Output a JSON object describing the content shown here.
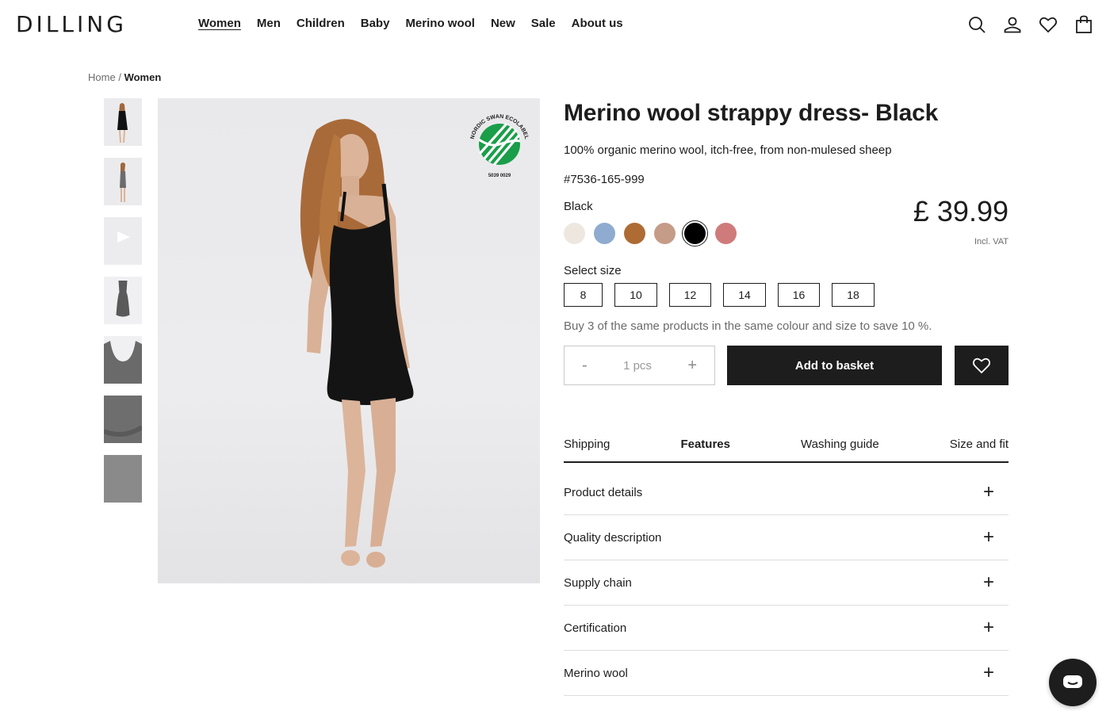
{
  "header": {
    "logo": "DILLING",
    "nav": [
      "Women",
      "Men",
      "Children",
      "Baby",
      "Merino wool",
      "New",
      "Sale",
      "About us"
    ],
    "active_nav": "Women",
    "icons": [
      "search-icon",
      "account-icon",
      "wishlist-icon",
      "basket-icon"
    ]
  },
  "breadcrumb": {
    "home": "Home",
    "separator": "/",
    "current": "Women"
  },
  "gallery": {
    "thumbnail_count": 7,
    "badge": {
      "arc_text": "NORDIC SWAN ECOLABEL",
      "number": "5039 0029"
    }
  },
  "product": {
    "title": "Merino wool strappy dress- Black",
    "subtitle": "100% organic merino wool, itch-free, from non-mulesed sheep",
    "sku": "#7536-165-999",
    "color_label": "Black",
    "colors": [
      "#ede7df",
      "#8fabcf",
      "#ae6b34",
      "#c49c88",
      "#000000",
      "#d07b7b"
    ],
    "selected_color_index": 4,
    "price": "£ 39.99",
    "vat_note": "Incl. VAT",
    "size_label": "Select size",
    "sizes": [
      "8",
      "10",
      "12",
      "14",
      "16",
      "18"
    ],
    "promo": "Buy 3 of the same products in the same colour and size to save 10 %.",
    "quantity": {
      "minus": "-",
      "value": "1 pcs",
      "plus": "+"
    },
    "add_to_basket": "Add to basket"
  },
  "tabs": {
    "items": [
      "Shipping",
      "Features",
      "Washing guide",
      "Size and fit"
    ],
    "active": "Features"
  },
  "accordion": {
    "items": [
      "Product details",
      "Quality description",
      "Supply chain",
      "Certification",
      "Merino wool"
    ],
    "expand_symbol": "+"
  },
  "chat": {
    "icon": "chat-icon"
  }
}
